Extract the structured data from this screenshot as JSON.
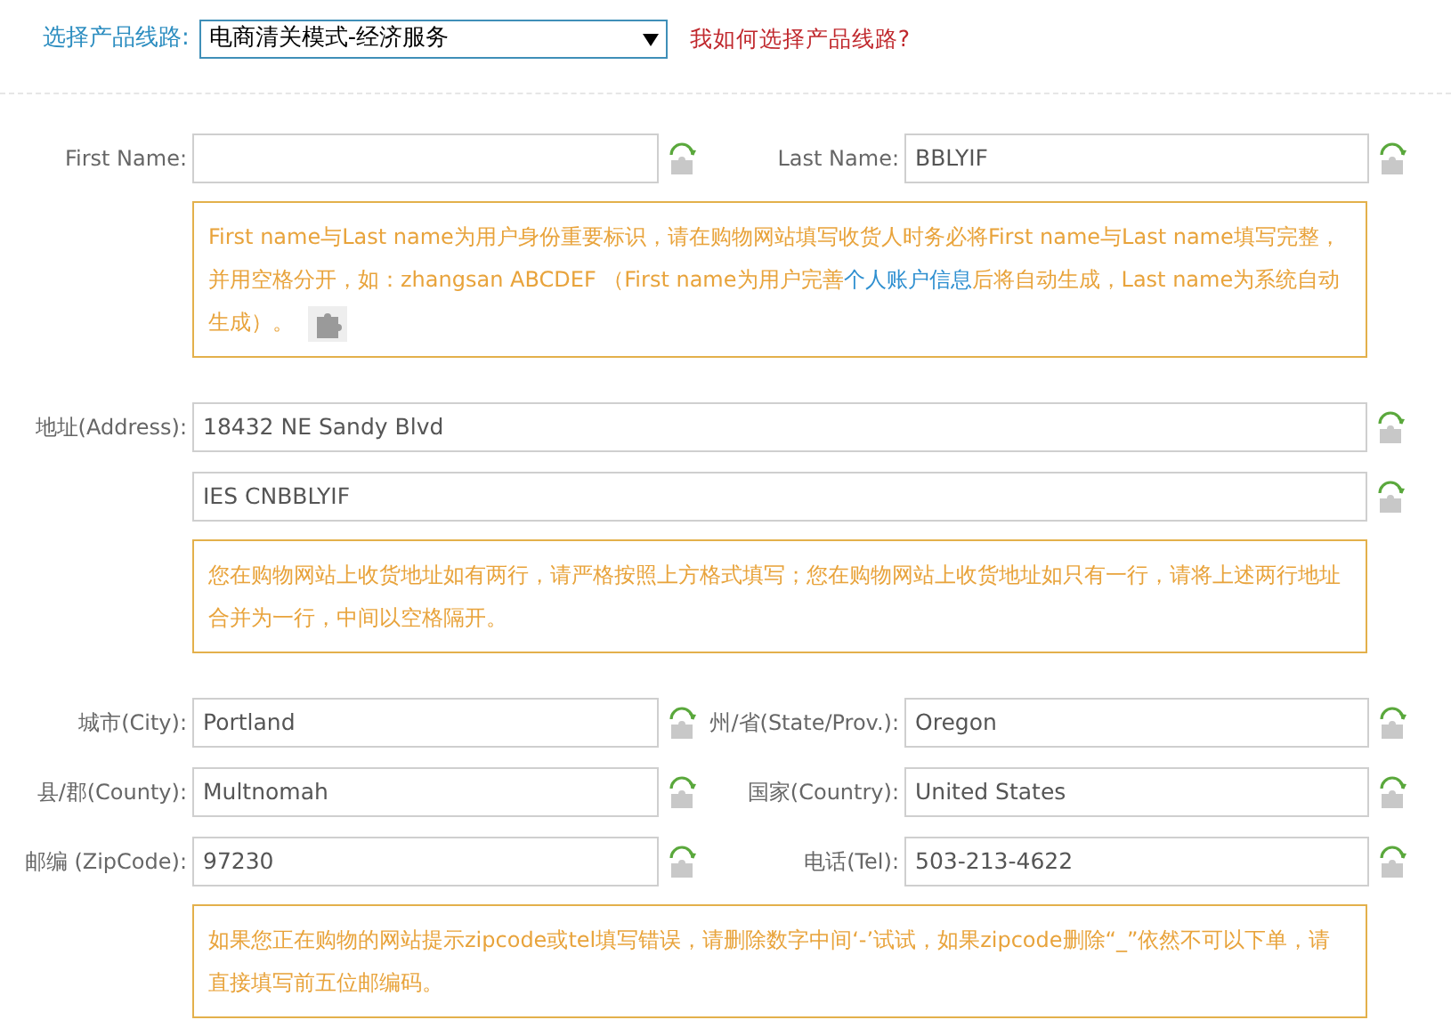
{
  "product_line": {
    "label": "选择产品线路:",
    "value": "电商清关模式-经济服务",
    "help_link": "我如何选择产品线路?"
  },
  "rows": [
    {
      "kind": "pair",
      "left": {
        "label": "First Name:"
      },
      "right": {
        "label": "Last Name:",
        "value": "BBLYIF"
      }
    },
    {
      "kind": "note",
      "segments": [
        {
          "kind": "text",
          "text": "First name与Last name为用户身份重要标识，请在购物网站填写收货人时务必将First name与Last name填写完整，并用空格分开，如：zhangsan ABCDEF （First name为用户完善"
        },
        {
          "kind": "link",
          "text": "个人账户信息"
        },
        {
          "kind": "text",
          "text": "后将自动生成，Last name为系统自动生成）。"
        },
        {
          "kind": "puzzle"
        }
      ]
    },
    {
      "kind": "full",
      "label": "地址(Address):",
      "value": "18432 NE Sandy Blvd"
    },
    {
      "kind": "full",
      "value": "IES CNBBLYIF"
    },
    {
      "kind": "note",
      "segments": [
        {
          "kind": "text",
          "text": "您在购物网站上收货地址如有两行，请严格按照上方格式填写；您在购物网站上收货地址如只有一行，请将上述两行地址合并为一行，中间以空格隔开。"
        }
      ]
    },
    {
      "kind": "pair",
      "left": {
        "label": "城市(City):",
        "value": "Portland"
      },
      "right": {
        "label": "州/省(State/Prov.):",
        "value": "Oregon"
      }
    },
    {
      "kind": "pair",
      "left": {
        "label": "县/郡(County):",
        "value": "Multnomah"
      },
      "right": {
        "label": "国家(Country):",
        "value": "United States"
      }
    },
    {
      "kind": "pair",
      "left": {
        "label": "邮编 (ZipCode):",
        "value": "97230"
      },
      "right": {
        "label": "电话(Tel):",
        "value": "503-213-4622"
      }
    },
    {
      "kind": "note",
      "segments": [
        {
          "kind": "text",
          "text": "如果您正在购物的网站提示zipcode或tel填写错误，请删除数字中间‘-’试试，如果zipcode删除“_”依然不可以下单，请直接填写前五位邮编码。"
        }
      ]
    }
  ]
}
